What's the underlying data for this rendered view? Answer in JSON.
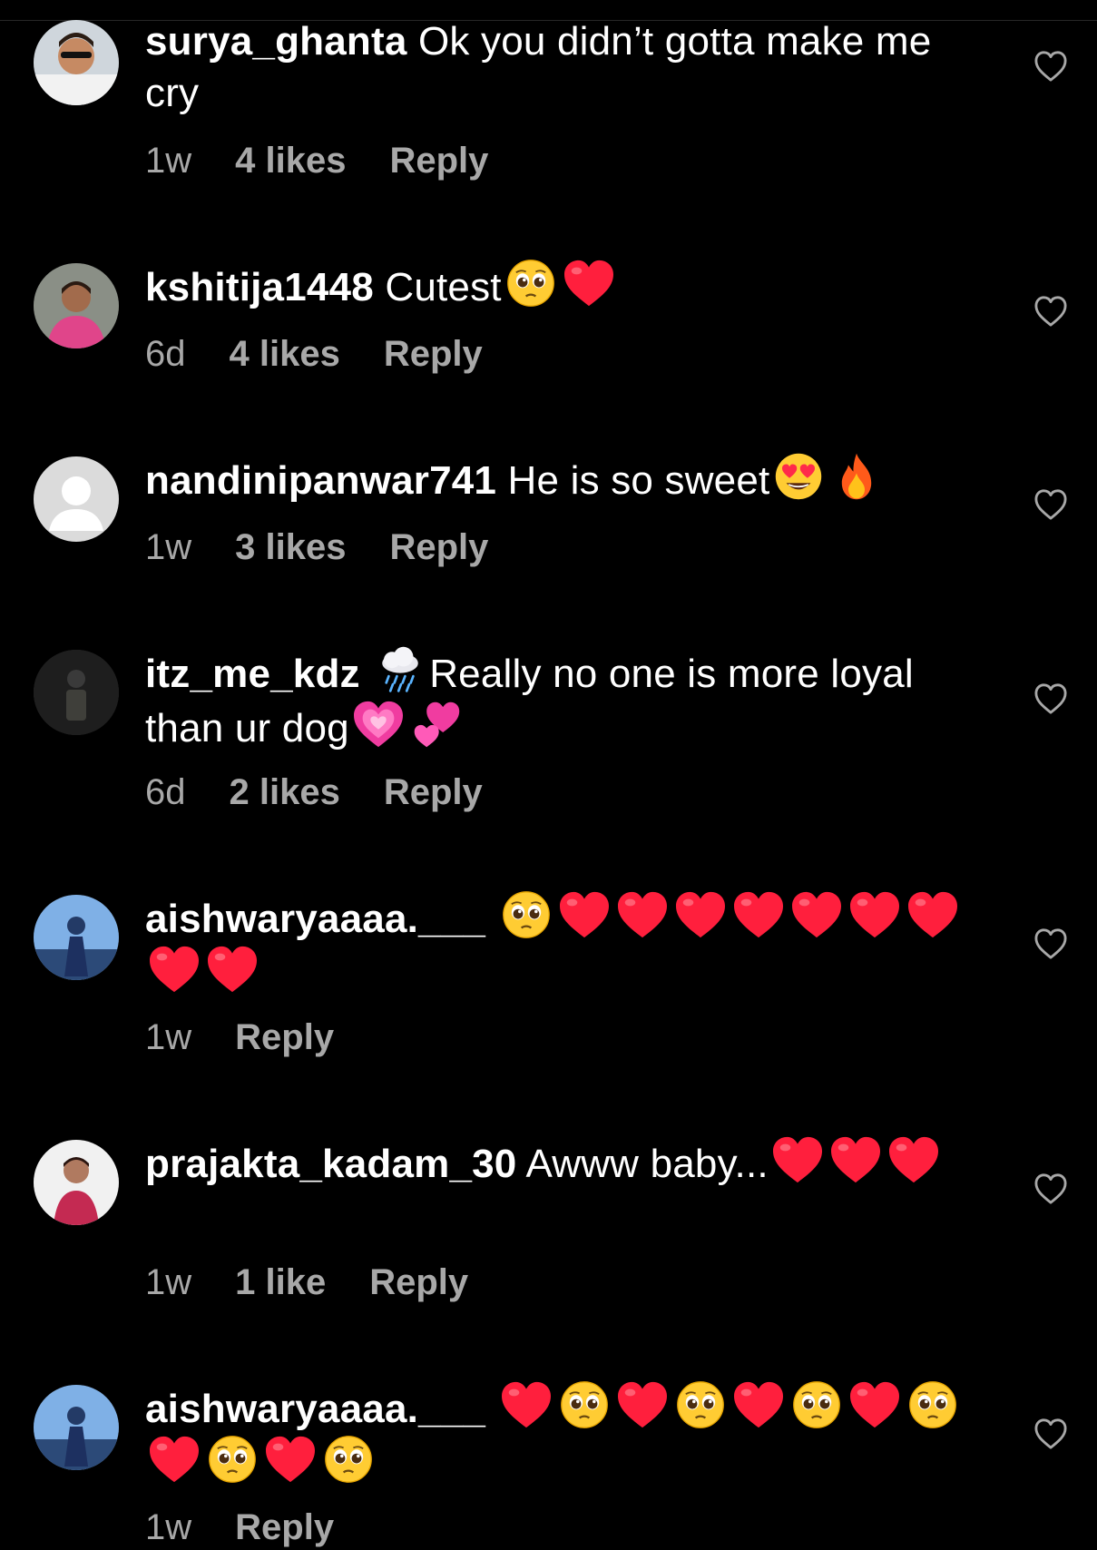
{
  "comments": [
    {
      "username": "surya_ghanta",
      "text": "Ok you didn’t gotta make me cry",
      "emojis": [],
      "time": "1w",
      "likes": "4 likes",
      "reply": "Reply"
    },
    {
      "username": "kshitija1448",
      "text": "Cutest",
      "emojis": [
        "pleading-face",
        "red-heart"
      ],
      "time": "6d",
      "likes": "4 likes",
      "reply": "Reply"
    },
    {
      "username": "nandinipanwar741",
      "text": "He is so sweet",
      "emojis": [
        "heart-eyes-face",
        "fire"
      ],
      "time": "1w",
      "likes": "3 likes",
      "reply": "Reply"
    },
    {
      "username": "itz_me_kdz",
      "text_prefix_emoji": "rain-cloud",
      "text": "Really no one is more loyal than ur dog",
      "emojis": [
        "growing-heart",
        "two-hearts"
      ],
      "time": "6d",
      "likes": "2 likes",
      "reply": "Reply"
    },
    {
      "username": "aishwaryaaaa.___",
      "text": "",
      "emojis": [
        "pleading-face",
        "red-heart",
        "red-heart",
        "red-heart",
        "red-heart",
        "red-heart",
        "red-heart",
        "red-heart",
        "red-heart",
        "red-heart"
      ],
      "time": "1w",
      "likes": "",
      "reply": "Reply"
    },
    {
      "username": "prajakta_kadam_30",
      "text": "Awww baby...",
      "emojis": [
        "red-heart",
        "red-heart",
        "red-heart"
      ],
      "time": "1w",
      "likes": "1 like",
      "reply": "Reply"
    },
    {
      "username": "aishwaryaaaa.___",
      "text": "",
      "emojis": [
        "red-heart",
        "pleading-face",
        "red-heart",
        "pleading-face",
        "red-heart",
        "pleading-face",
        "red-heart",
        "pleading-face",
        "red-heart",
        "pleading-face",
        "red-heart",
        "pleading-face"
      ],
      "time": "1w",
      "likes": "",
      "reply": "Reply"
    }
  ],
  "icons": {
    "like": "heart-outline-icon"
  },
  "colors": {
    "background": "#000000",
    "text": "#ffffff",
    "meta": "#a8a8a8"
  }
}
